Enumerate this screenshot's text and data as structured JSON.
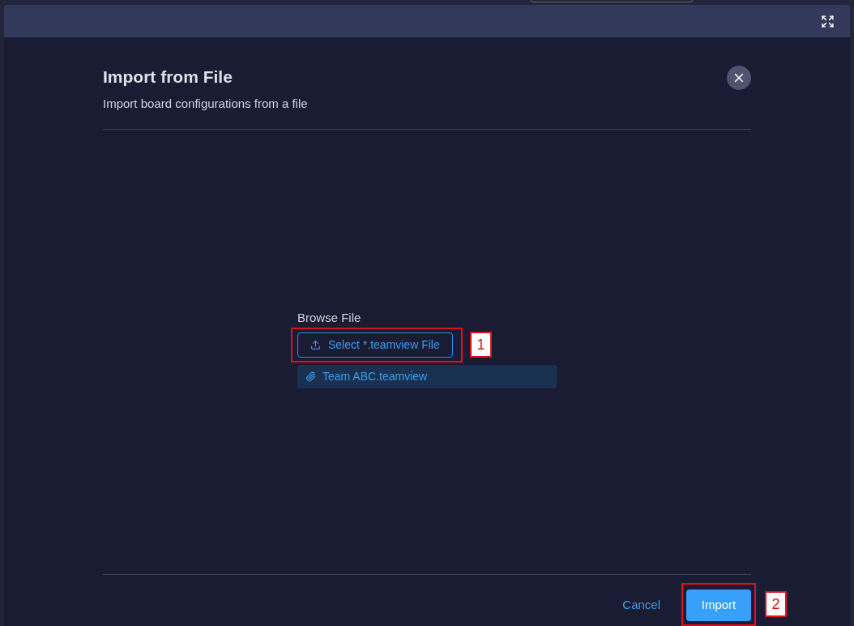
{
  "dialog": {
    "title": "Import from File",
    "subtitle": "Import board configurations from a file"
  },
  "browse": {
    "label": "Browse File",
    "select_button": "Select *.teamview File",
    "file": "Team ABC.teamview"
  },
  "footer": {
    "cancel": "Cancel",
    "import": "Import"
  },
  "callouts": [
    "1",
    "2"
  ]
}
